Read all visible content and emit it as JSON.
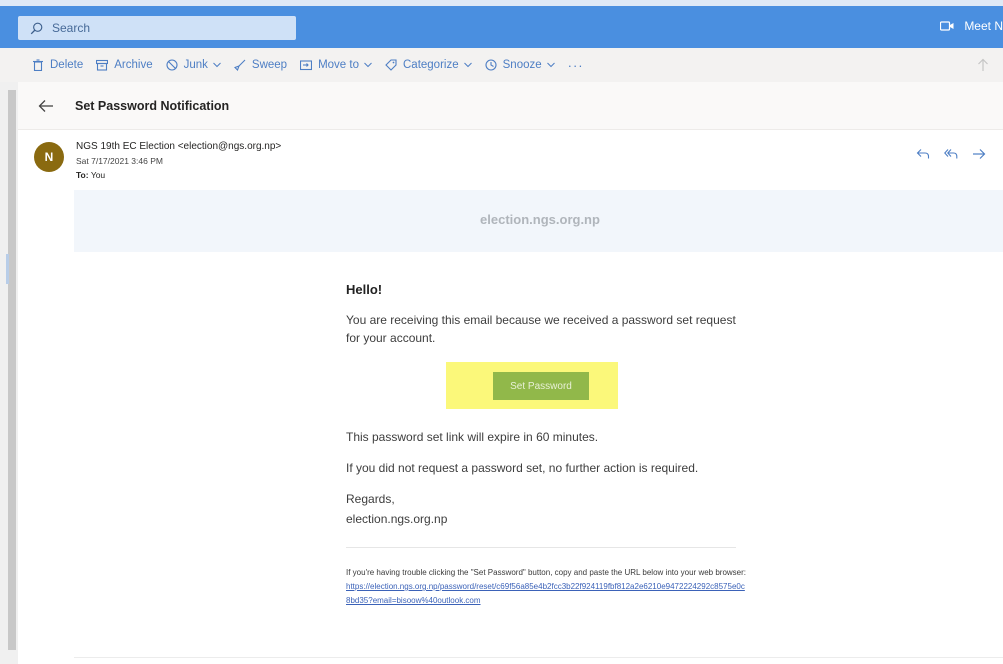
{
  "search": {
    "placeholder": "Search"
  },
  "meet": {
    "label": "Meet N"
  },
  "toolbar": {
    "delete": "Delete",
    "archive": "Archive",
    "junk": "Junk",
    "sweep": "Sweep",
    "move_to": "Move to",
    "categorize": "Categorize",
    "snooze": "Snooze",
    "more": "···"
  },
  "message": {
    "subject": "Set Password Notification",
    "avatar_initial": "N",
    "from": "NGS 19th EC Election <election@ngs.org.np>",
    "date": "Sat 7/17/2021 3:46 PM",
    "to_label": "To:",
    "to_value": "You"
  },
  "body": {
    "banner": "election.ngs.org.np",
    "greeting": "Hello!",
    "intro": "You are receiving this email because we received a password set request for your account.",
    "button": "Set Password",
    "expire": "This password set link will expire in 60 minutes.",
    "no_action": "If you did not request a password set, no further action is required.",
    "regards": "Regards,",
    "signature": "election.ngs.org.np",
    "trouble": "If you're having trouble clicking the \"Set Password\" button, copy and paste the URL below into your web browser:",
    "url": "https://election.ngs.org.np/password/reset/c69f56a85e4b2fcc3b22f924119fbf812a2e6210e9472224292c8575e0c8bd35?email=bisoow%40outlook.com"
  },
  "colors": {
    "topbar": "#4a8fe0",
    "accent": "#4d7ec4",
    "button": "#91b84a",
    "highlight": "#fbf87a",
    "avatar": "#8a6a10"
  }
}
